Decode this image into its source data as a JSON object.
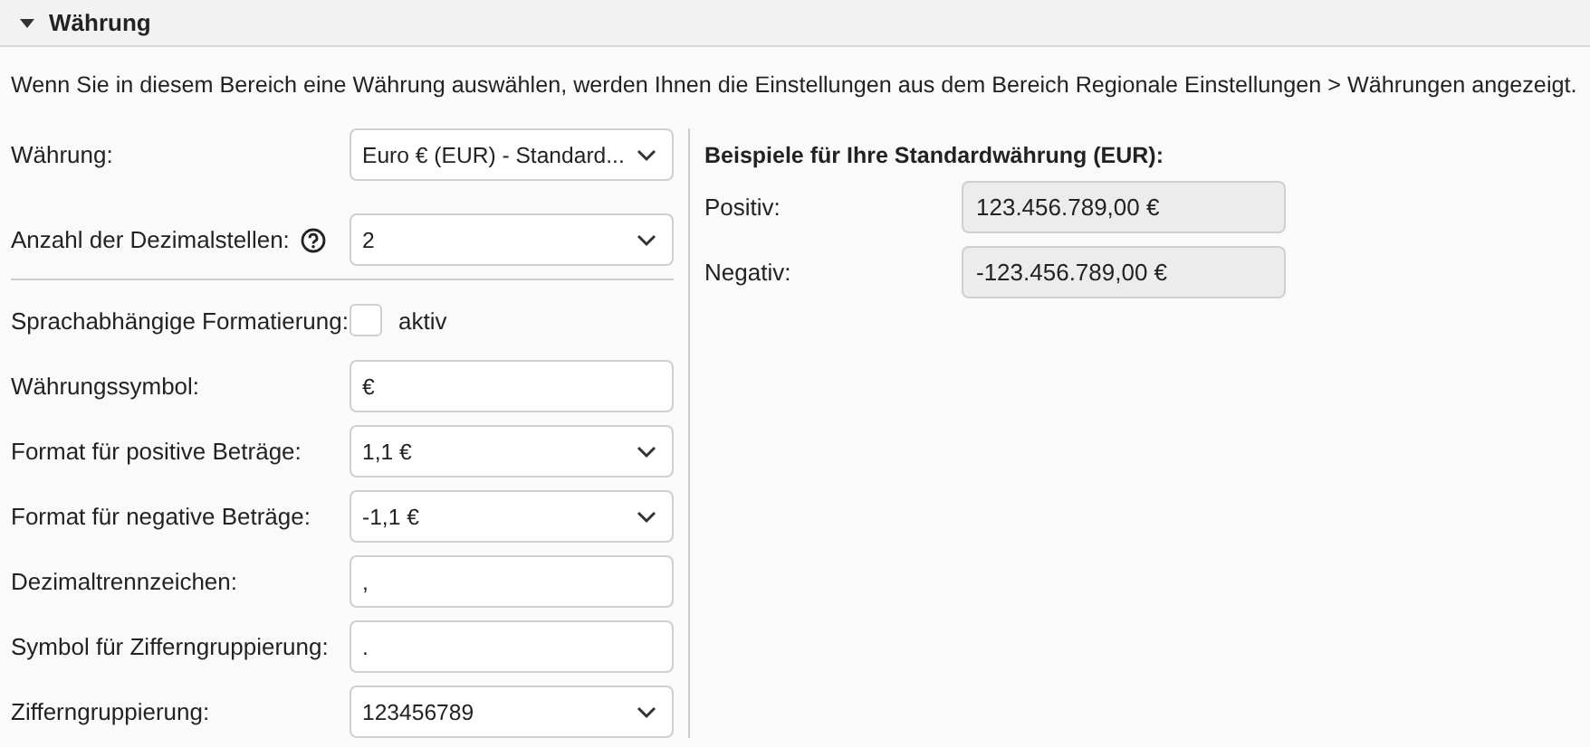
{
  "section": {
    "title": "Währung",
    "expanded": true
  },
  "description": "Wenn Sie in diesem Bereich eine Währung auswählen, werden Ihnen die Einstellungen aus dem Bereich Regionale Einstellungen > Währungen angezeigt.",
  "currency_fields": [
    {
      "label": "Währung:",
      "kind": "select",
      "value": "Euro € (EUR) - Standard...",
      "help": false
    },
    {
      "label": "Anzahl der Dezimalstellen:",
      "kind": "select",
      "value": "2",
      "help": true
    }
  ],
  "format_fields": [
    {
      "label": "Sprachabhängige Formatierung:",
      "kind": "checkbox",
      "checked": false,
      "option": "aktiv"
    },
    {
      "label": "Währungssymbol:",
      "kind": "input",
      "value": "€"
    },
    {
      "label": "Format für positive Beträge:",
      "kind": "select",
      "value": "1,1 €"
    },
    {
      "label": "Format für negative Beträge:",
      "kind": "select",
      "value": "-1,1 €"
    },
    {
      "label": "Dezimaltrennzeichen:",
      "kind": "input",
      "value": ","
    },
    {
      "label": "Symbol für Zifferngruppierung:",
      "kind": "input",
      "value": "."
    },
    {
      "label": "Zifferngruppierung:",
      "kind": "select",
      "value": "123456789"
    }
  ],
  "examples": {
    "title": "Beispiele für Ihre Standardwährung (EUR):",
    "rows": [
      {
        "label": "Positiv:",
        "value": "123.456.789,00 €"
      },
      {
        "label": "Negativ:",
        "value": "-123.456.789,00 €"
      }
    ]
  }
}
